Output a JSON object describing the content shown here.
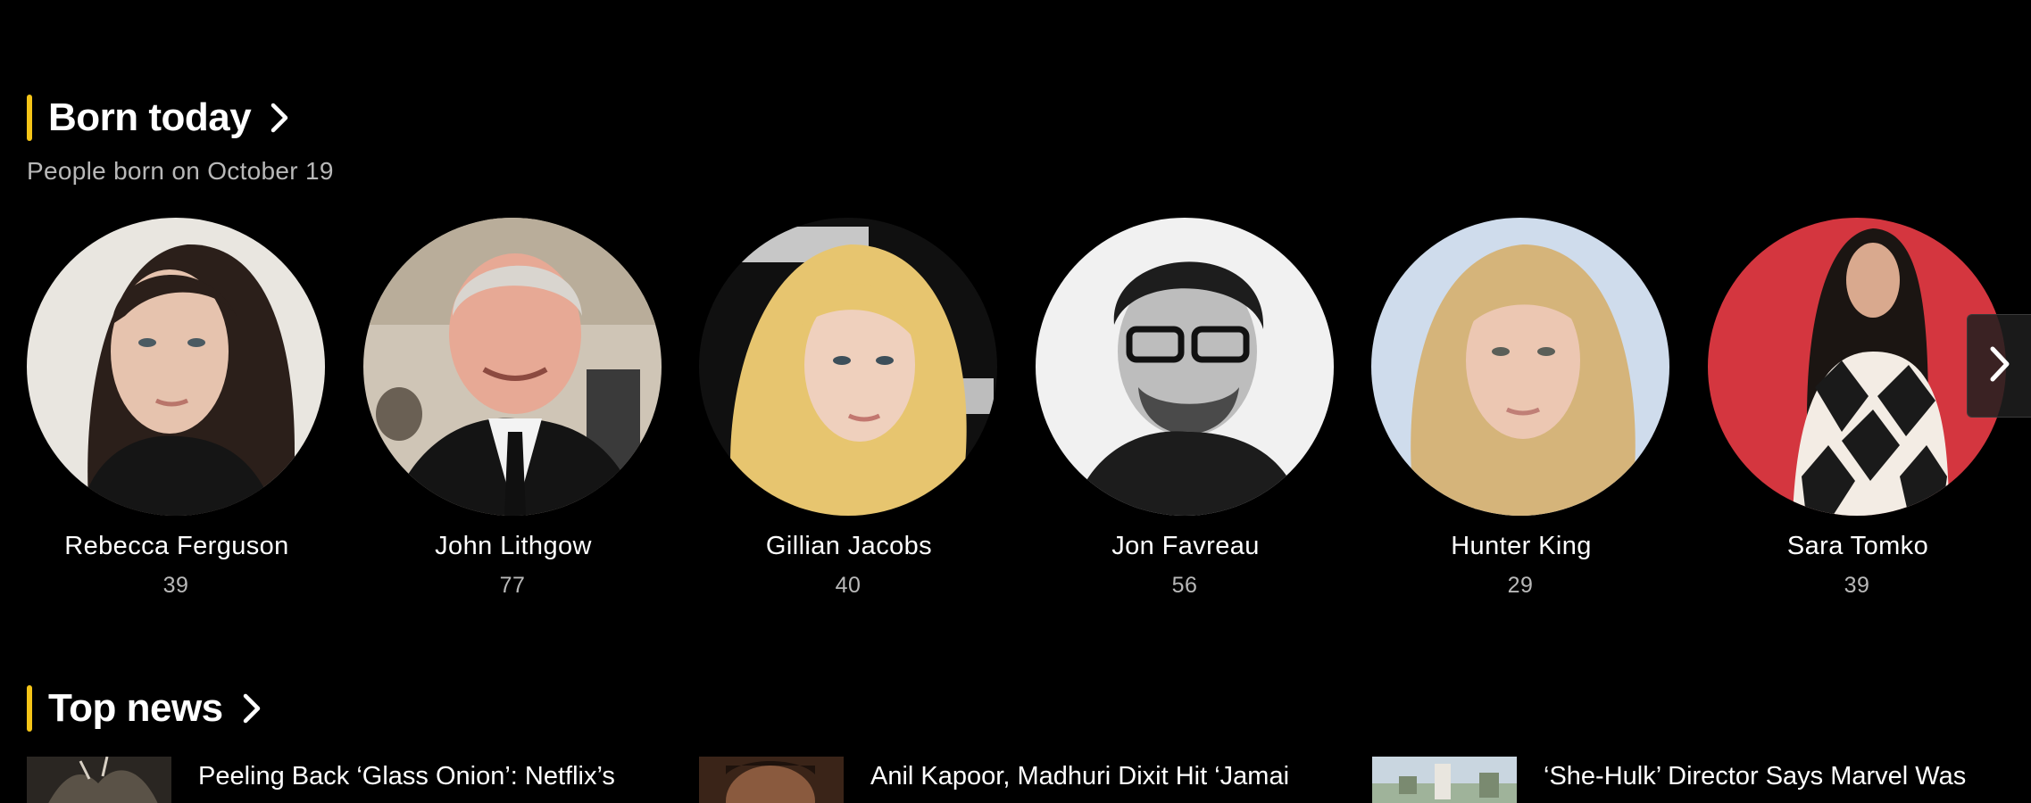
{
  "born_today": {
    "title": "Born today",
    "subtitle": "People born on October 19",
    "people": [
      {
        "name": "Rebecca Ferguson",
        "age": "39",
        "bg": "#e9e6e0",
        "hair": "#2b1f1a",
        "skin": "#e6c3ae",
        "cloth": "#151515"
      },
      {
        "name": "John Lithgow",
        "age": "77",
        "bg": "#cfc5b6",
        "hair": "#d9d5cf",
        "skin": "#e7a995",
        "cloth": "#141414"
      },
      {
        "name": "Gillian Jacobs",
        "age": "40",
        "bg": "#101010",
        "hair": "#e7c56f",
        "skin": "#efd0bd",
        "cloth": "#d9b35f"
      },
      {
        "name": "Jon Favreau",
        "age": "56",
        "bg": "#f1f1f1",
        "hair": "#1d1d1d",
        "skin": "#bdbdbd",
        "cloth": "#1c1c1c"
      },
      {
        "name": "Hunter King",
        "age": "29",
        "bg": "#cfdcec",
        "hair": "#d5b47a",
        "skin": "#ecc7b2",
        "cloth": "#c8a06a"
      },
      {
        "name": "Sara Tomko",
        "age": "39",
        "bg": "#d4363f",
        "hair": "#1b1512",
        "skin": "#d9a98e",
        "cloth": "#f3ece4"
      }
    ]
  },
  "top_news": {
    "title": "Top news",
    "items": [
      {
        "headline": "Peeling Back ‘Glass Onion’: Netflix’s",
        "thumb_color": "#5a5247"
      },
      {
        "headline": "Anil Kapoor, Madhuri Dixit Hit ‘Jamai",
        "thumb_color": "#8a5a3e"
      },
      {
        "headline": "‘She-Hulk’ Director Says Marvel Was",
        "thumb_color": "#9fb39a"
      }
    ]
  },
  "colors": {
    "accent": "#f5c518",
    "background": "#000000",
    "text": "#ffffff",
    "muted": "#b8b8b8"
  },
  "icons": {
    "section_chevron": "chevron-right-icon",
    "carousel_next": "chevron-right-icon"
  }
}
